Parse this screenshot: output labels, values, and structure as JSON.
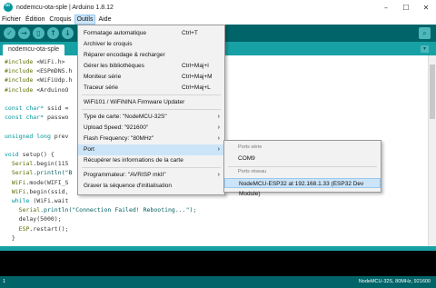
{
  "window": {
    "title": "nodemcu-ota-sple | Arduino 1.8.12",
    "controls": [
      "–",
      "☐",
      "✕"
    ]
  },
  "menubar": {
    "items": [
      "Fichier",
      "Édition",
      "Croquis",
      "Outils",
      "Aide"
    ],
    "active": "Outils"
  },
  "toolbar": {
    "buttons": [
      "verify-icon",
      "upload-icon",
      "new-icon",
      "open-icon",
      "save-icon"
    ],
    "serial_monitor_icon": "magnifier-icon"
  },
  "tab": {
    "label": "nodemcu-ota-sple",
    "menu_icon": "tab-menu-arrow-icon"
  },
  "editor": {
    "lines": [
      {
        "pp": "#include",
        "rest": " <WiFi.h>"
      },
      {
        "pp": "#include",
        "rest": " <ESPmDNS.h"
      },
      {
        "pp": "#include",
        "rest": " <WiFiUdp.h"
      },
      {
        "pp": "#include",
        "rest": " <ArduinoO"
      },
      {
        "pp": "",
        "rest": ""
      },
      {
        "pp": "const char*",
        "rest": " ssid ="
      },
      {
        "pp": "const char*",
        "rest": " passwo"
      },
      {
        "pp": "",
        "rest": ""
      },
      {
        "pp": "unsigned long",
        "rest": " prev"
      },
      {
        "pp": "",
        "rest": ""
      },
      {
        "pp": "void",
        "rest": " setup() {"
      },
      {
        "pp": "  Serial",
        "rest": ".begin(115"
      },
      {
        "pp": "  Serial",
        "rest": ".println(\"B"
      },
      {
        "pp": "  WiFi",
        "rest": ".mode(WIFI_S"
      },
      {
        "pp": "  WiFi",
        "rest": ".begin(ssid,"
      },
      {
        "pp": "  while",
        "rest": " (WiFi.wait"
      },
      {
        "pp": "    Serial",
        "rest": ".println(\"Connection Failed! Rebooting...\");"
      },
      {
        "pp": "    delay",
        "rest": "(5000);"
      },
      {
        "pp": "    ESP",
        "rest": ".restart();"
      },
      {
        "pp": "  }",
        "rest": ""
      }
    ]
  },
  "statusbar": {
    "line": "1",
    "board": "NodeMCU-32S, 80MHz, 921600"
  },
  "outils_menu": {
    "items": [
      {
        "label": "Formatage automatique",
        "shortcut": "Ctrl+T",
        "arrow": ""
      },
      {
        "label": "Archiver le croquis",
        "shortcut": "",
        "arrow": ""
      },
      {
        "label": "Réparer encodage & recharger",
        "shortcut": "",
        "arrow": ""
      },
      {
        "label": "Gérer les bibliothèques",
        "shortcut": "Ctrl+Maj+I",
        "arrow": ""
      },
      {
        "label": "Moniteur série",
        "shortcut": "Ctrl+Maj+M",
        "arrow": ""
      },
      {
        "label": "Traceur série",
        "shortcut": "Ctrl+Maj+L",
        "arrow": ""
      },
      {
        "label": "WiFi101 / WiFiNINA Firmware Updater",
        "shortcut": "",
        "arrow": ""
      },
      {
        "label": "Type de carte: \"NodeMCU-32S\"",
        "shortcut": "",
        "arrow": "›"
      },
      {
        "label": "Upload Speed: \"921600\"",
        "shortcut": "",
        "arrow": "›"
      },
      {
        "label": "Flash Frequency: \"80MHz\"",
        "shortcut": "",
        "arrow": "›"
      },
      {
        "label": "Port",
        "shortcut": "",
        "arrow": "›"
      },
      {
        "label": "Récupérer les informations de la carte",
        "shortcut": "",
        "arrow": ""
      },
      {
        "label": "Programmateur: \"AVRISP mkII\"",
        "shortcut": "",
        "arrow": "›"
      },
      {
        "label": "Graver la séquence d'initialisation",
        "shortcut": "",
        "arrow": ""
      }
    ],
    "hover_index": 10
  },
  "port_submenu": {
    "serial_header": "Ports série",
    "serial_ports": [
      "COM9"
    ],
    "network_header": "Ports réseau",
    "network_ports": [
      "NodeMCU-ESP32 at 192.168.1.33 (ESP32 Dev Module)"
    ],
    "selected": "NodeMCU-ESP32 at 192.168.1.33 (ESP32 Dev Module)"
  },
  "colors": {
    "toolbar": "#006468",
    "tabbar": "#17a1a5",
    "menu_hover": "#cce4f7"
  }
}
